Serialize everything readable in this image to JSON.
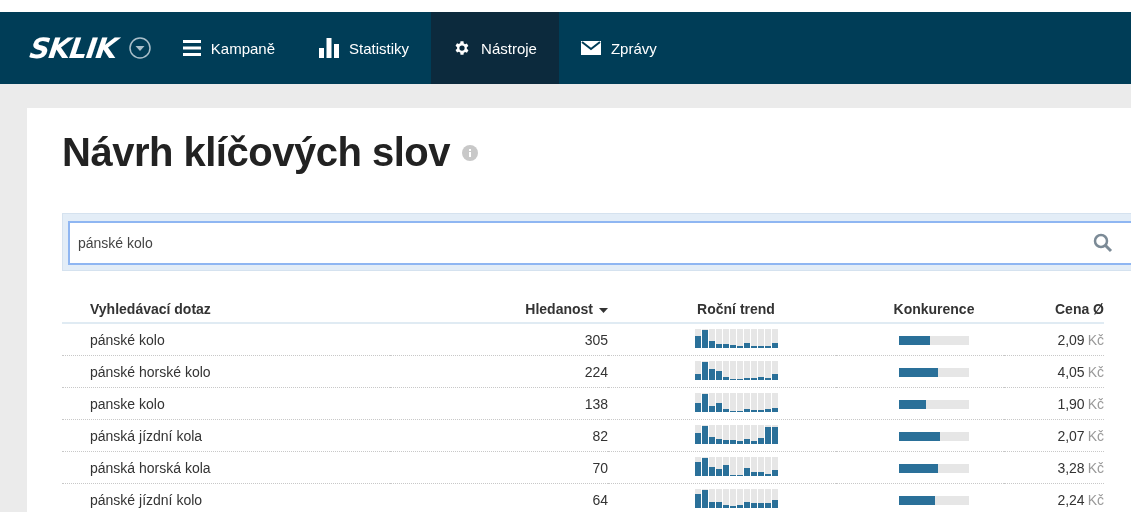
{
  "nav": {
    "logo": "SKLIK",
    "items": [
      {
        "label": "Kampaně",
        "selected": false
      },
      {
        "label": "Statistiky",
        "selected": false
      },
      {
        "label": "Nástroje",
        "selected": true
      },
      {
        "label": "Zprávy",
        "selected": false
      }
    ]
  },
  "title": "Návrh klíčových slov",
  "search": {
    "value": "pánské kolo"
  },
  "table": {
    "columns": [
      {
        "label": "Vyhledávací dotaz",
        "sorted": false
      },
      {
        "label": "Hledanost",
        "sorted": true
      },
      {
        "label": "Roční trend",
        "sorted": false
      },
      {
        "label": "Konkurence",
        "sorted": false
      },
      {
        "label": "Cena Ø",
        "sorted": false
      }
    ],
    "rows": [
      {
        "query": "pánské kolo",
        "volume": "305",
        "competition": {
          "level": 0.44
        },
        "price": "2,09",
        "currency": "Kč"
      },
      {
        "query": "pánské horské kolo",
        "volume": "224",
        "competition": {
          "level": 0.55
        },
        "price": "4,05",
        "currency": "Kč"
      },
      {
        "query": "panske kolo",
        "volume": "138",
        "competition": {
          "level": 0.39
        },
        "price": "1,90",
        "currency": "Kč"
      },
      {
        "query": "pánská jízdní kola",
        "volume": "82",
        "competition": {
          "level": 0.58
        },
        "price": "2,07",
        "currency": "Kč"
      },
      {
        "query": "pánská horská kola",
        "volume": "70",
        "competition": {
          "level": 0.55
        },
        "price": "3,28",
        "currency": "Kč"
      },
      {
        "query": "pánské jízdní kolo",
        "volume": "64",
        "competition": {
          "level": 0.52
        },
        "price": "2,24",
        "currency": "Kč"
      }
    ]
  }
}
